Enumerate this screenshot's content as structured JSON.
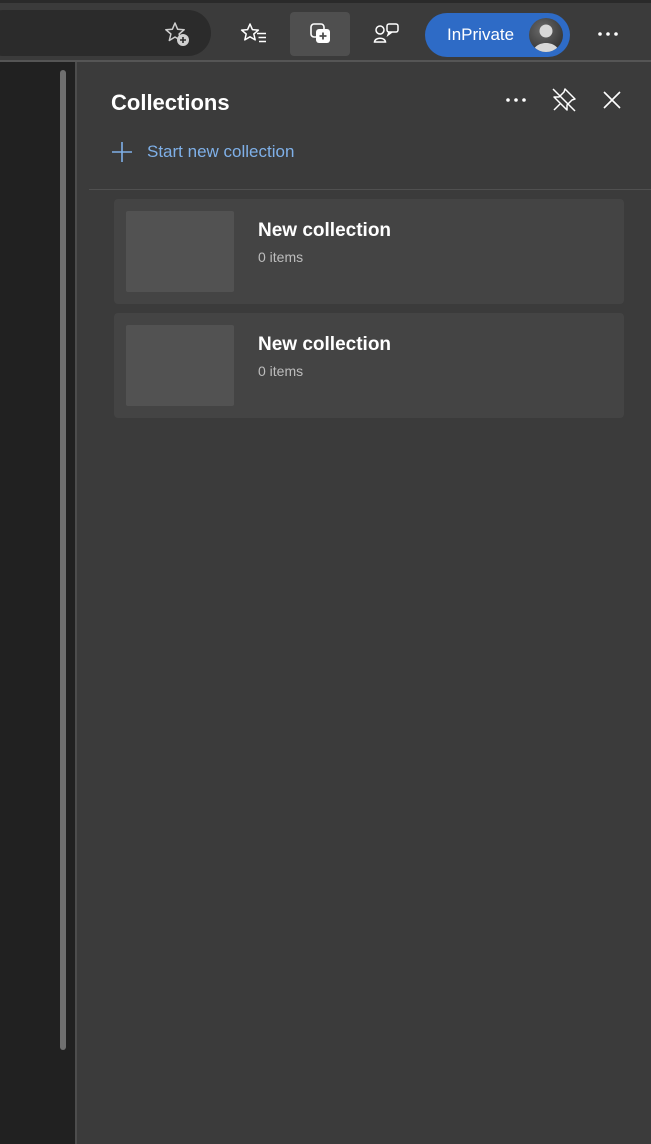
{
  "toolbar": {
    "inprivate_label": "InPrivate",
    "icons": {
      "add_favorite": "star-add-icon",
      "favorites": "favorites-icon",
      "collections": "collections-icon",
      "feedback": "feedback-icon",
      "profile": "avatar",
      "menu": "more-icon"
    }
  },
  "panel": {
    "title": "Collections",
    "start_new_label": "Start new collection",
    "collections": [
      {
        "title": "New collection",
        "count": "0 items"
      },
      {
        "title": "New collection",
        "count": "0 items"
      }
    ]
  },
  "colors": {
    "background": "#3b3b3b",
    "inprivate_accent": "#2e6bc6",
    "link": "#7fb0e8",
    "card": "#444444"
  }
}
